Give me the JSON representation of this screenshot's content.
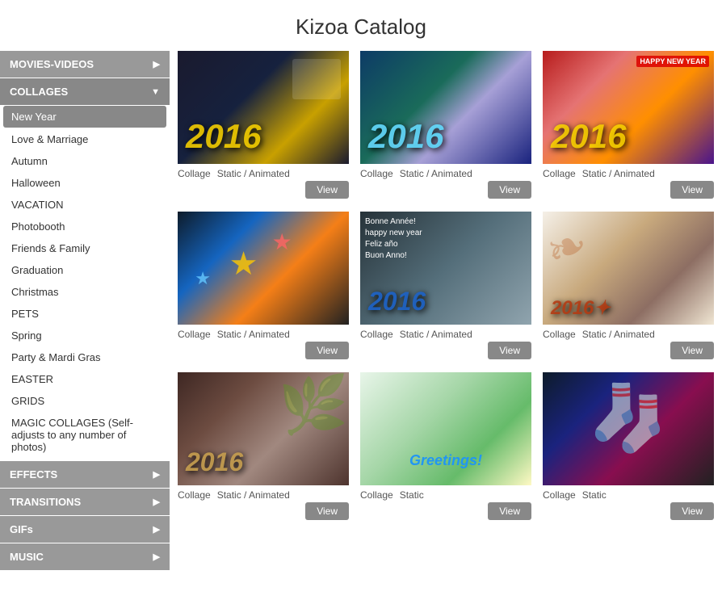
{
  "page": {
    "title": "Kizoa Catalog"
  },
  "sidebar": {
    "sections": [
      {
        "id": "movies-videos",
        "label": "MOVIES-VIDEOS",
        "arrow": "▶",
        "active": false,
        "items": []
      },
      {
        "id": "collages",
        "label": "COLLAGES",
        "arrow": "▼",
        "active": true,
        "items": [
          {
            "id": "new-year",
            "label": "New Year",
            "selected": true
          },
          {
            "id": "love-marriage",
            "label": "Love & Marriage",
            "selected": false
          },
          {
            "id": "autumn",
            "label": "Autumn",
            "selected": false
          },
          {
            "id": "halloween",
            "label": "Halloween",
            "selected": false
          },
          {
            "id": "vacation",
            "label": "VACATION",
            "selected": false
          },
          {
            "id": "photobooth",
            "label": "Photobooth",
            "selected": false
          },
          {
            "id": "friends-family",
            "label": "Friends & Family",
            "selected": false
          },
          {
            "id": "graduation",
            "label": "Graduation",
            "selected": false
          },
          {
            "id": "christmas",
            "label": "Christmas",
            "selected": false
          },
          {
            "id": "pets",
            "label": "PETS",
            "selected": false
          },
          {
            "id": "spring",
            "label": "Spring",
            "selected": false
          },
          {
            "id": "party-mardi-gras",
            "label": "Party & Mardi Gras",
            "selected": false
          },
          {
            "id": "easter",
            "label": "EASTER",
            "selected": false
          },
          {
            "id": "grids",
            "label": "GRIDS",
            "selected": false
          },
          {
            "id": "magic-collages",
            "label": "MAGIC COLLAGES (Self-adjusts to any number of photos)",
            "selected": false
          }
        ]
      },
      {
        "id": "effects",
        "label": "EFFECTS",
        "arrow": "▶",
        "active": false,
        "items": []
      },
      {
        "id": "transitions",
        "label": "TRANSITIONS",
        "arrow": "▶",
        "active": false,
        "items": []
      },
      {
        "id": "gifs",
        "label": "GIFs",
        "arrow": "▶",
        "active": false,
        "items": []
      },
      {
        "id": "music",
        "label": "MUSIC",
        "arrow": "▶",
        "active": false,
        "items": []
      }
    ]
  },
  "collages": {
    "items": [
      {
        "id": "col-1",
        "label": "Collage",
        "type": "Static / Animated",
        "btn_label": "View",
        "thumb_class": "thumb-1",
        "year": "2016",
        "has_year": true,
        "has_hny": false,
        "has_greetings": false
      },
      {
        "id": "col-2",
        "label": "Collage",
        "type": "Static / Animated",
        "btn_label": "View",
        "thumb_class": "thumb-2",
        "year": "2016",
        "has_year": true,
        "has_hny": false,
        "has_greetings": false
      },
      {
        "id": "col-3",
        "label": "Collage",
        "type": "Static / Animated",
        "btn_label": "View",
        "thumb_class": "thumb-3",
        "year": "2016",
        "has_year": true,
        "has_hny": true,
        "has_greetings": false
      },
      {
        "id": "col-4",
        "label": "Collage",
        "type": "Static / Animated",
        "btn_label": "View",
        "thumb_class": "thumb-4",
        "year": "",
        "has_year": false,
        "has_hny": false,
        "has_greetings": false
      },
      {
        "id": "col-5",
        "label": "Collage",
        "type": "Static / Animated",
        "btn_label": "View",
        "thumb_class": "thumb-5",
        "year": "2016",
        "has_year": true,
        "has_hny": false,
        "has_greetings": false
      },
      {
        "id": "col-6",
        "label": "Collage",
        "type": "Static / Animated",
        "btn_label": "View",
        "thumb_class": "thumb-6",
        "year": "2016",
        "has_year": true,
        "has_hny": false,
        "has_greetings": false
      },
      {
        "id": "col-7",
        "label": "Collage",
        "type": "Static / Animated",
        "btn_label": "View",
        "thumb_class": "thumb-7",
        "year": "2016",
        "has_year": true,
        "has_hny": false,
        "has_greetings": false
      },
      {
        "id": "col-8",
        "label": "Collage",
        "type": "Static",
        "btn_label": "View",
        "thumb_class": "thumb-8",
        "year": "",
        "has_year": false,
        "has_hny": false,
        "has_greetings": true
      },
      {
        "id": "col-9",
        "label": "Collage",
        "type": "Static",
        "btn_label": "View",
        "thumb_class": "thumb-9",
        "year": "",
        "has_year": false,
        "has_hny": false,
        "has_greetings": false
      }
    ]
  }
}
